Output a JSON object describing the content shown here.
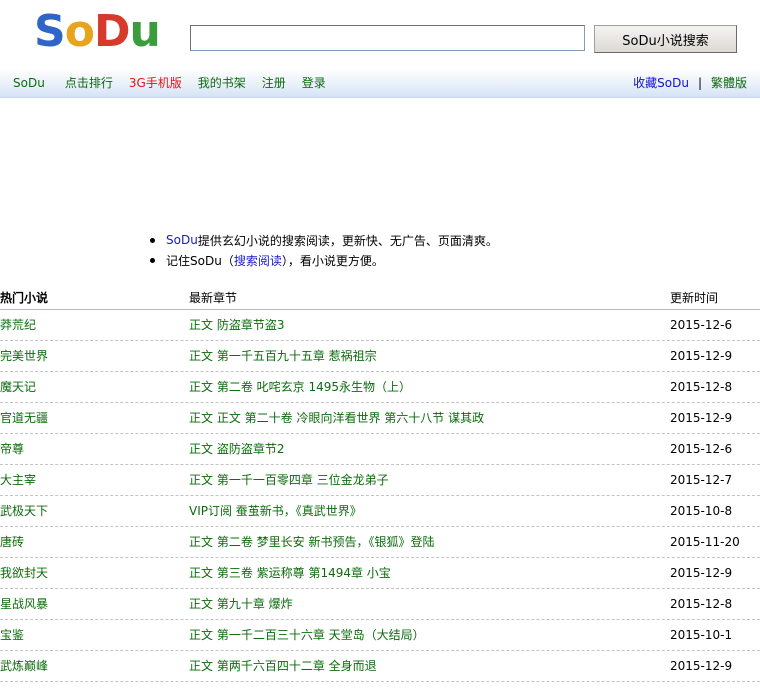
{
  "logo": {
    "parts": [
      "S",
      "o",
      "D",
      "u"
    ]
  },
  "search": {
    "value": "",
    "button_label": "SoDu小说搜索"
  },
  "nav": {
    "left": [
      "SoDu",
      "点击排行",
      "3G手机版",
      "我的书架",
      "注册",
      "登录"
    ],
    "right": {
      "favorite": "收藏SoDu",
      "separator": "|",
      "traditional": "繁體版"
    }
  },
  "notices": {
    "n1_link": "SoDu",
    "n1_text": "提供玄幻小说的搜索阅读，更新快、无广告、页面清爽。",
    "n2_a": "记住SoDu（",
    "n2_link": "搜索阅读",
    "n2_b": "），看小说更方便。"
  },
  "table": {
    "headers": [
      "热门小说",
      "最新章节",
      "更新时间"
    ],
    "rows": [
      [
        "莽荒纪",
        "正文  防盗章节盗3",
        "2015-12-6"
      ],
      [
        "完美世界",
        "正文  第一千五百九十五章  惹祸祖宗",
        "2015-12-9"
      ],
      [
        "魔天记",
        "正文  第二卷  叱咤玄京  1495永生物（上）",
        "2015-12-8"
      ],
      [
        "官道无疆",
        "正文  正文  第二十卷  冷眼向洋看世界  第六十八节  谋其政",
        "2015-12-9"
      ],
      [
        "帝尊",
        "正文  盗防盗章节2",
        "2015-12-6"
      ],
      [
        "大主宰",
        "正文  第一千一百零四章  三位金龙弟子",
        "2015-12-7"
      ],
      [
        "武极天下",
        "VIP订阅  蚕茧新书，《真武世界》",
        "2015-10-8"
      ],
      [
        "唐砖",
        "正文  第二卷  梦里长安  新书预告，《银狐》登陆",
        "2015-11-20"
      ],
      [
        "我欲封天",
        "正文  第三卷  紫运称尊  第1494章  小宝",
        "2015-12-9"
      ],
      [
        "星战风暴",
        "正文  第九十章  爆炸",
        "2015-12-8"
      ],
      [
        "宝鉴",
        "正文  第一千二百三十六章  天堂岛（大结局）",
        "2015-10-1"
      ],
      [
        "武炼巅峰",
        "正文  第两千六百四十二章  全身而退",
        "2015-12-9"
      ]
    ]
  }
}
